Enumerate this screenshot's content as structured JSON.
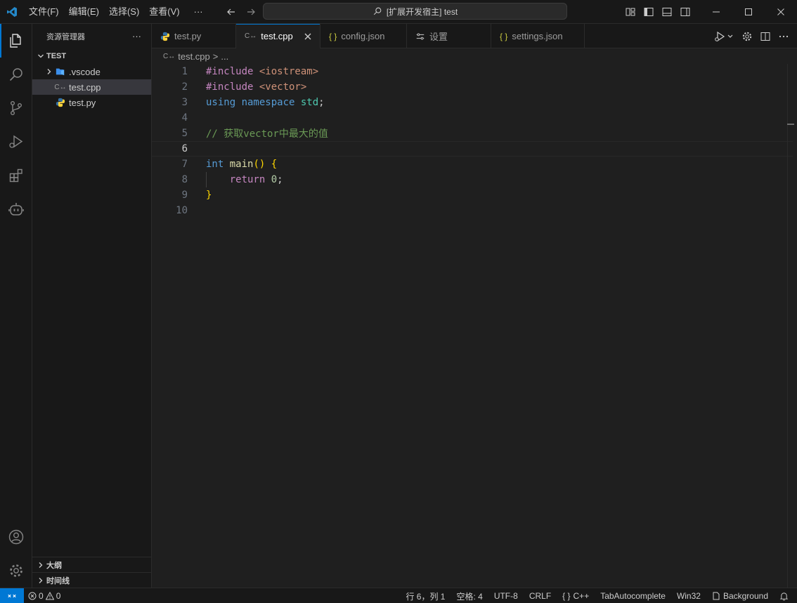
{
  "titlebar": {
    "menu": [
      "文件(F)",
      "编辑(E)",
      "选择(S)",
      "查看(V)",
      "···"
    ],
    "command_center": "[扩展开发宿主] test",
    "colors": {
      "accent": "#0078d4",
      "logo": "#2489ca"
    }
  },
  "activity": {
    "items": [
      "explorer",
      "search",
      "source-control",
      "run-debug",
      "extensions",
      "copilot"
    ],
    "bottom": [
      "accounts",
      "manage"
    ]
  },
  "sidebar": {
    "title": "资源管理器",
    "more": "···",
    "root": "TEST",
    "items": [
      {
        "label": ".vscode",
        "type": "folder"
      },
      {
        "label": "test.cpp",
        "type": "cpp",
        "icon_text": "C↔"
      },
      {
        "label": "test.py",
        "type": "py"
      }
    ],
    "outline": "大纲",
    "timeline": "时间线"
  },
  "tabs": [
    {
      "label": "test.py",
      "icon": "python-icon"
    },
    {
      "label": "test.cpp",
      "icon": "cpp-icon",
      "icon_text": "C↔",
      "active": true
    },
    {
      "label": "config.json",
      "icon": "json-icon",
      "icon_text": "{ }"
    },
    {
      "label": "设置",
      "icon": "settings-icon"
    },
    {
      "label": "settings.json",
      "icon": "json-icon",
      "icon_text": "{ }"
    }
  ],
  "breadcrumb": {
    "icon_text": "C↔",
    "file": "test.cpp",
    "sep": ">",
    "more": "..."
  },
  "editor": {
    "current_line": 6,
    "lines": [
      {
        "n": "1",
        "tokens": [
          [
            "k-dir",
            "#include "
          ],
          [
            "k-str",
            "<iostream>"
          ]
        ]
      },
      {
        "n": "2",
        "tokens": [
          [
            "k-dir",
            "#include "
          ],
          [
            "k-str",
            "<vector>"
          ]
        ]
      },
      {
        "n": "3",
        "tokens": [
          [
            "k-kw",
            "using "
          ],
          [
            "k-kw",
            "namespace "
          ],
          [
            "k-ns",
            "std"
          ],
          [
            "k-punc",
            ";"
          ]
        ]
      },
      {
        "n": "4",
        "tokens": []
      },
      {
        "n": "5",
        "tokens": [
          [
            "k-cm",
            "// 获取vector中最大的值"
          ]
        ]
      },
      {
        "n": "6",
        "tokens": []
      },
      {
        "n": "7",
        "tokens": [
          [
            "k-kw",
            "int "
          ],
          [
            "k-fn",
            "main"
          ],
          [
            "k-brace",
            "()"
          ],
          [
            "k-punc",
            " "
          ],
          [
            "k-brace",
            "{"
          ]
        ]
      },
      {
        "n": "8",
        "tokens": [
          [
            "k-punc",
            "    "
          ],
          [
            "k-ctrl",
            "return "
          ],
          [
            "k-num",
            "0"
          ],
          [
            "k-punc",
            ";"
          ]
        ]
      },
      {
        "n": "9",
        "tokens": [
          [
            "k-brace",
            "}"
          ]
        ]
      },
      {
        "n": "10",
        "tokens": []
      }
    ]
  },
  "status": {
    "errors": "0",
    "warnings": "0",
    "position": "行 6，列 1",
    "spaces": "空格: 4",
    "encoding": "UTF-8",
    "eol": "CRLF",
    "lang_icon": "{ }",
    "language": "C++",
    "ext": "TabAutocomplete",
    "platform": "Win32",
    "background": "Background"
  }
}
